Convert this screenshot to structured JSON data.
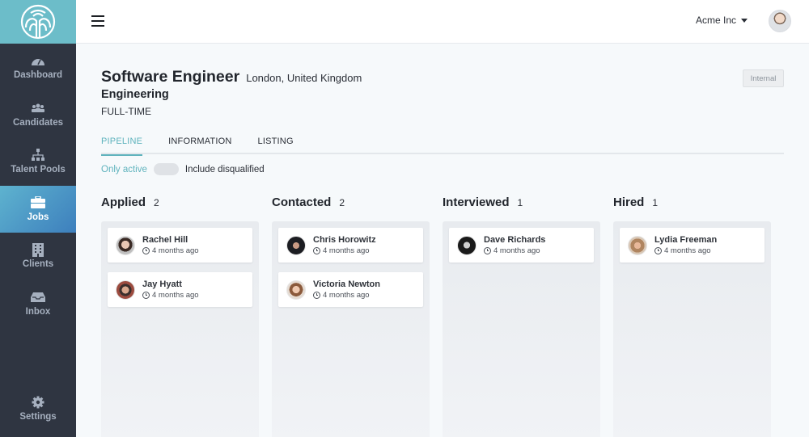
{
  "sidebar": {
    "logo": "tree-logo",
    "items": [
      {
        "label": "Dashboard",
        "icon": "dashboard-icon"
      },
      {
        "label": "Candidates",
        "icon": "candidates-icon"
      },
      {
        "label": "Talent Pools",
        "icon": "talent-pools-icon"
      },
      {
        "label": "Jobs",
        "icon": "briefcase-icon",
        "active": true
      },
      {
        "label": "Clients",
        "icon": "building-icon"
      },
      {
        "label": "Inbox",
        "icon": "inbox-icon"
      }
    ],
    "settings": {
      "label": "Settings",
      "icon": "gear-icon"
    }
  },
  "topbar": {
    "company": "Acme Inc"
  },
  "job": {
    "title": "Software Engineer",
    "location": "London, United Kingdom",
    "department": "Engineering",
    "type": "FULL-TIME",
    "badge": "Internal"
  },
  "tabs": [
    {
      "label": "PIPELINE",
      "active": true
    },
    {
      "label": "INFORMATION"
    },
    {
      "label": "LISTING"
    }
  ],
  "filter": {
    "only_active": "Only active",
    "include_disqualified": "Include disqualified",
    "toggle_on": false
  },
  "columns": [
    {
      "name": "Applied",
      "count": "2",
      "cards": [
        {
          "name": "Rachel Hill",
          "time": "4 months ago"
        },
        {
          "name": "Jay Hyatt",
          "time": "4 months ago"
        }
      ]
    },
    {
      "name": "Contacted",
      "count": "2",
      "cards": [
        {
          "name": "Chris Horowitz",
          "time": "4 months ago"
        },
        {
          "name": "Victoria Newton",
          "time": "4 months ago"
        }
      ]
    },
    {
      "name": "Interviewed",
      "count": "1",
      "cards": [
        {
          "name": "Dave Richards",
          "time": "4 months ago"
        }
      ]
    },
    {
      "name": "Hired",
      "count": "1",
      "cards": [
        {
          "name": "Lydia Freeman",
          "time": "4 months ago"
        }
      ]
    }
  ],
  "colors": {
    "accent": "#5fb3bd",
    "sidebar_bg": "#2f3541",
    "logo_bg": "#6cbdc9"
  }
}
